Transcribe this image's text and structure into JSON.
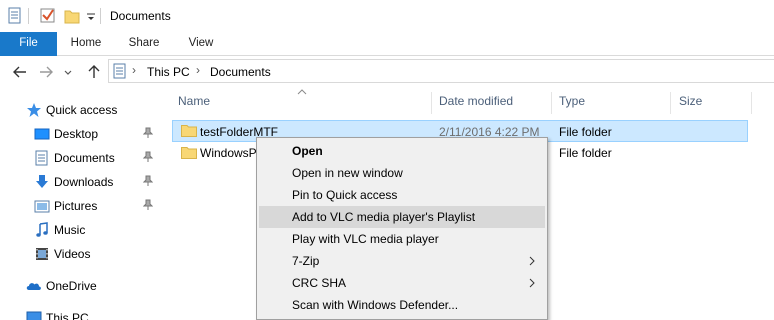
{
  "window": {
    "title": "Documents"
  },
  "ribbon": {
    "tabs": [
      "File",
      "Home",
      "Share",
      "View"
    ]
  },
  "address": {
    "crumbs": [
      "This PC",
      "Documents"
    ]
  },
  "nav_pane": {
    "items": [
      {
        "label": "Quick access",
        "icon": "star-icon"
      },
      {
        "label": "Desktop",
        "icon": "desktop-icon",
        "pinned": true
      },
      {
        "label": "Documents",
        "icon": "documents-icon",
        "pinned": true
      },
      {
        "label": "Downloads",
        "icon": "download-icon",
        "pinned": true
      },
      {
        "label": "Pictures",
        "icon": "pictures-icon",
        "pinned": true
      },
      {
        "label": "Music",
        "icon": "music-icon"
      },
      {
        "label": "Videos",
        "icon": "videos-icon"
      },
      {
        "label": "OneDrive",
        "icon": "cloud-icon"
      },
      {
        "label": "This PC",
        "icon": "computer-icon"
      }
    ]
  },
  "file_list": {
    "columns": [
      "Name",
      "Date modified",
      "Type",
      "Size"
    ],
    "rows": [
      {
        "name": "testFolderMTF",
        "date": "2/11/2016 4:22 PM",
        "type": "File folder",
        "size": "",
        "selected": true
      },
      {
        "name": "WindowsP",
        "date": "",
        "type": "File folder",
        "size": "",
        "selected": false
      }
    ]
  },
  "context_menu": {
    "items": [
      {
        "label": "Open",
        "bold": true
      },
      {
        "label": "Open in new window"
      },
      {
        "label": "Pin to Quick access"
      },
      {
        "label": "Add to VLC media player's Playlist",
        "highlighted": true
      },
      {
        "label": "Play with VLC media player"
      },
      {
        "label": "7-Zip",
        "submenu": true
      },
      {
        "label": "CRC SHA",
        "submenu": true
      },
      {
        "label": "Scan with Windows Defender..."
      }
    ]
  },
  "colors": {
    "accent": "#1979ca",
    "selection": "#cce8ff",
    "selection_border": "#99d1ff",
    "folder": "#f8d775"
  }
}
